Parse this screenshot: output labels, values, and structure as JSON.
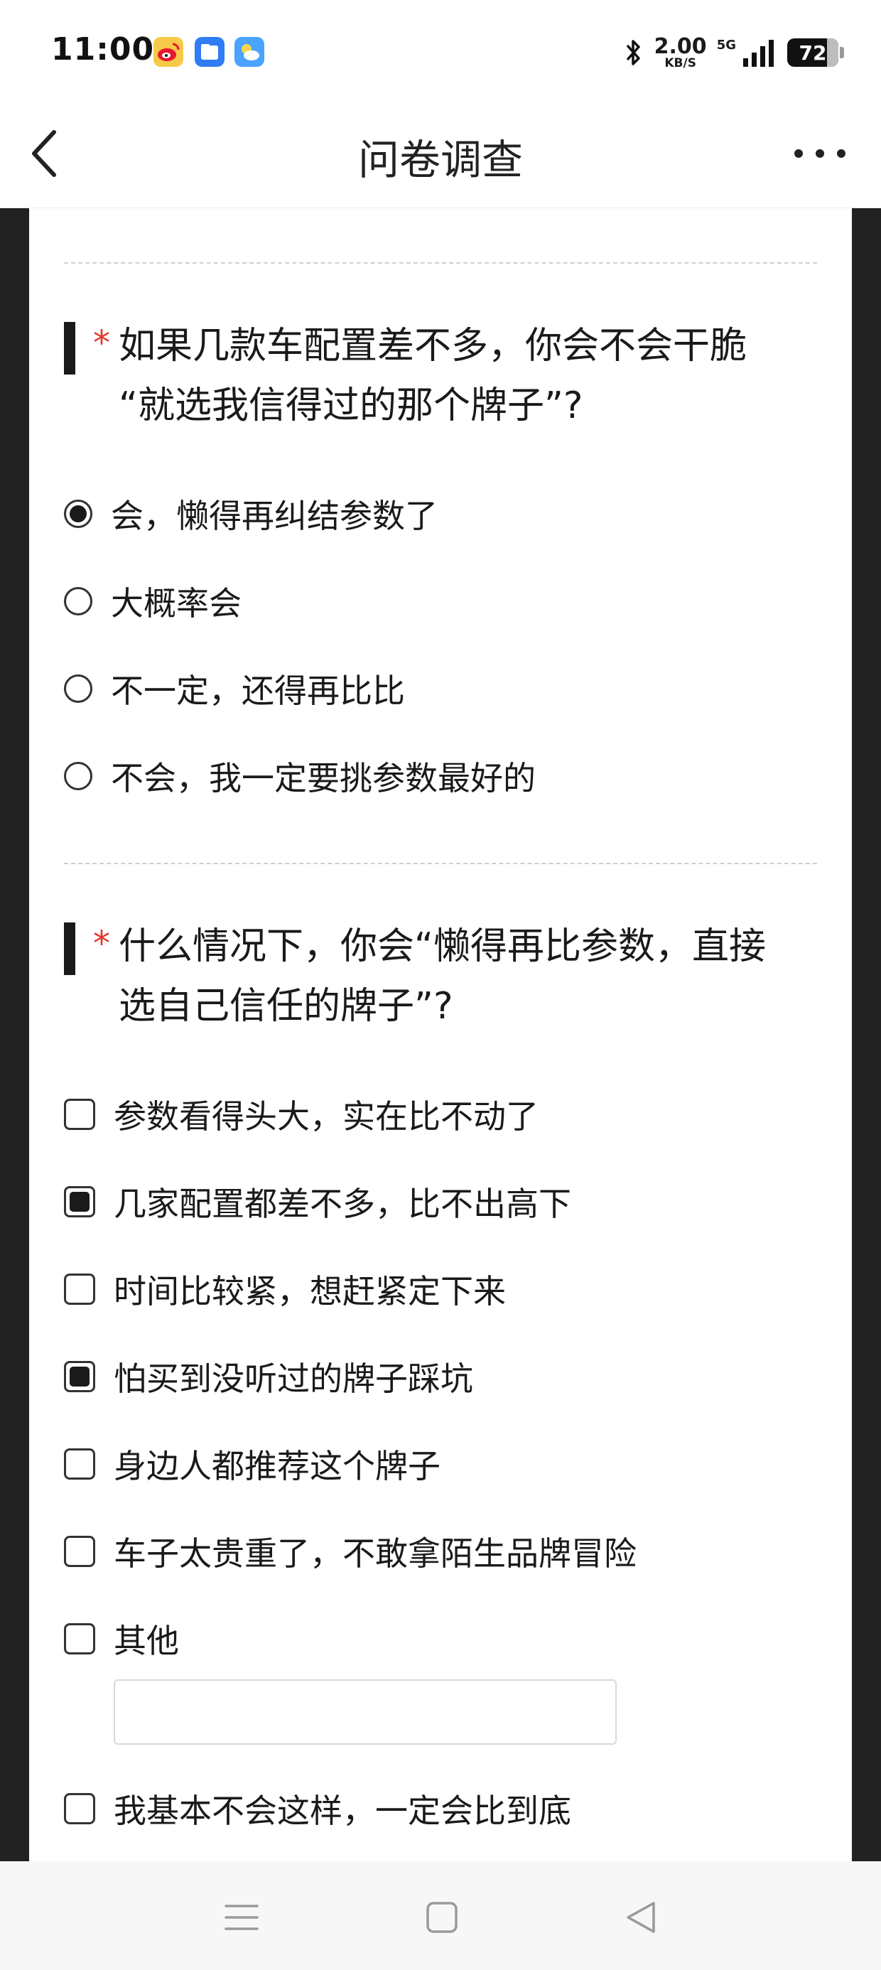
{
  "status_bar": {
    "time": "11:00",
    "apps": [
      {
        "icon": "weibo-icon",
        "color": "#f5a623"
      },
      {
        "icon": "files-icon",
        "color": "#2f7cf6"
      },
      {
        "icon": "weather-icon",
        "color": "#4aa3ff"
      }
    ],
    "network_speed": "2.00",
    "network_speed_unit": "KB/S",
    "network_type": "5G",
    "battery_level": "72"
  },
  "header": {
    "title": "问卷调查",
    "back_icon": "chevron-left-icon",
    "more_icon": "more-horizontal-icon"
  },
  "questions": [
    {
      "required_mark": "*",
      "text_line1": "如果几款车配置差不多，你会不会干脆",
      "text_line2": "“就选我信得过的那个牌子”?",
      "type": "single",
      "options": [
        {
          "label": "会，懒得再纠结参数了",
          "selected": true
        },
        {
          "label": "大概率会",
          "selected": false
        },
        {
          "label": "不一定，还得再比比",
          "selected": false
        },
        {
          "label": "不会，我一定要挑参数最好的",
          "selected": false
        }
      ]
    },
    {
      "required_mark": "*",
      "text_line1": "什么情况下，你会“懒得再比参数，直接",
      "text_line2": "选自己信任的牌子”?",
      "type": "multiple",
      "options": [
        {
          "label": "参数看得头大，实在比不动了",
          "selected": false
        },
        {
          "label": "几家配置都差不多，比不出高下",
          "selected": true
        },
        {
          "label": "时间比较紧，想赶紧定下来",
          "selected": false
        },
        {
          "label": "怕买到没听过的牌子踩坑",
          "selected": true
        },
        {
          "label": "身边人都推荐这个牌子",
          "selected": false
        },
        {
          "label": "车子太贵重了，不敢拿陌生品牌冒险",
          "selected": false
        },
        {
          "label": "其他",
          "selected": false,
          "other_input_value": ""
        },
        {
          "label": "我基本不会这样，一定会比到底",
          "selected": false
        }
      ]
    }
  ],
  "bottom_nav": {
    "menu_icon": "menu-icon",
    "home_icon": "home-square-icon",
    "back_icon": "back-triangle-icon"
  }
}
